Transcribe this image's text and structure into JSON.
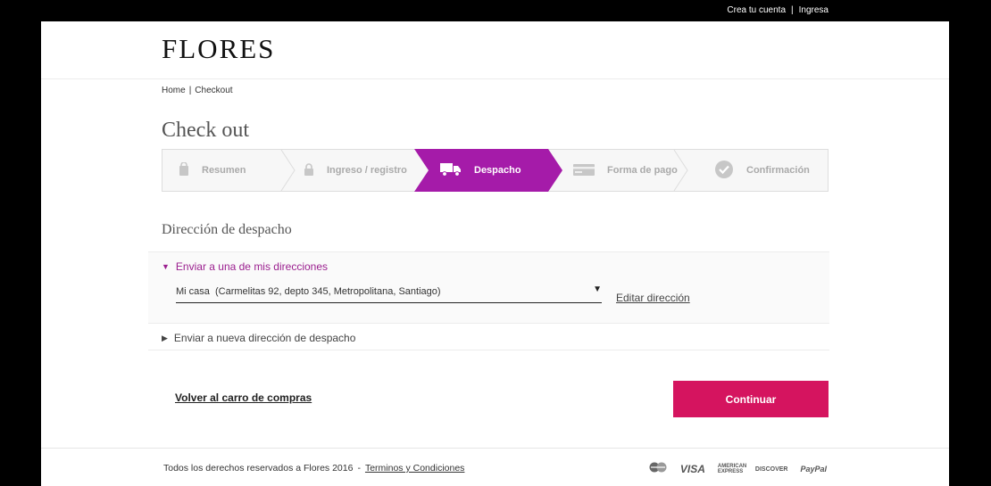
{
  "top_links": {
    "create_account": "Crea tu cuenta",
    "separator": "|",
    "login": "Ingresa"
  },
  "header": {
    "logo": "FLORES"
  },
  "breadcrumb": {
    "home": "Home",
    "separator": "|",
    "current": "Checkout"
  },
  "page_title": "Check out",
  "steps": [
    {
      "label": "Resumen",
      "icon": "bag-icon",
      "state": "inactive"
    },
    {
      "label": "Ingreso / registro",
      "icon": "lock-icon",
      "state": "inactive"
    },
    {
      "label": "Despacho",
      "icon": "truck-icon",
      "state": "active"
    },
    {
      "label": "Forma de pago",
      "icon": "credit-card-icon",
      "state": "inactive"
    },
    {
      "label": "Confirmación",
      "icon": "check-circle-icon",
      "state": "inactive"
    }
  ],
  "section_title": "Dirección de despacho",
  "shipping_options": {
    "saved": {
      "label": "Enviar a una de mis direcciones",
      "selected_address": "Mi casa  (Carmelitas 92, depto 345, Metropolitana, Santiago)",
      "edit_label": "Editar dirección"
    },
    "new": {
      "label": "Enviar a nueva dirección de despacho"
    }
  },
  "actions": {
    "back_label": "Volver al carro de compras",
    "continue_label": "Continuar"
  },
  "footer": {
    "copyright": "Todos los derechos reservados a Flores 2016",
    "separator": "-",
    "terms": "Terminos y Condiciones",
    "payments": [
      "mastercard",
      "VISA",
      "AMERICAN EXPRESS",
      "DISCOVER",
      "PayPal"
    ]
  },
  "colors": {
    "accent_purple": "#a51ba9",
    "brand_purple_text": "#9b1f8f",
    "button_pink": "#d5145f"
  }
}
